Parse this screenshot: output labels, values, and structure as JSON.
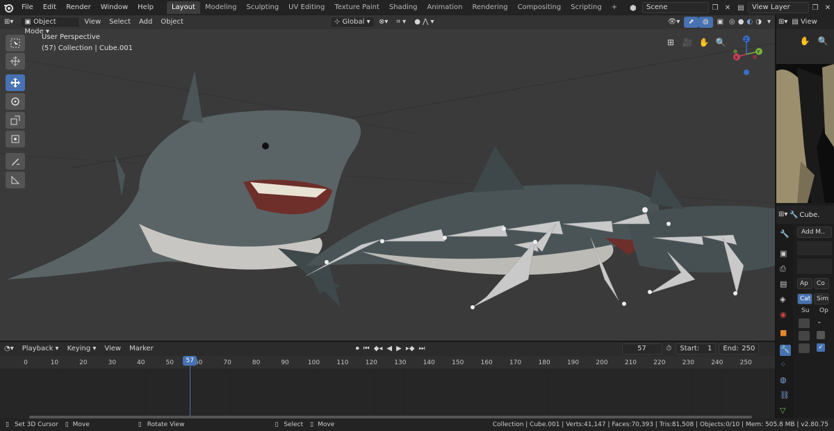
{
  "menu": [
    "File",
    "Edit",
    "Render",
    "Window",
    "Help"
  ],
  "workspaces": [
    "Layout",
    "Modeling",
    "Sculpting",
    "UV Editing",
    "Texture Paint",
    "Shading",
    "Animation",
    "Rendering",
    "Compositing",
    "Scripting"
  ],
  "active_workspace": "Layout",
  "add_tab": "+",
  "scene": "Scene",
  "view_layer": "View Layer",
  "viewport": {
    "mode": "Object Mode",
    "menus": [
      "View",
      "Select",
      "Add",
      "Object"
    ],
    "orientation": "Global",
    "info_line1": "User Perspective",
    "info_line2": "(57) Collection | Cube.001",
    "gizmo": {
      "z": "Z",
      "y": "Y",
      "x": "X"
    }
  },
  "image_editor": {
    "view_label": "View"
  },
  "properties": {
    "object_name": "Cube.",
    "add_modifier": "Add M..",
    "tab_ap": "Ap",
    "tab_co": "Co",
    "tab_cat": "Cat",
    "tab_sim": "Sim",
    "col_su": "Su",
    "col_op": "Op"
  },
  "timeline": {
    "menus": [
      "Playback",
      "Keying",
      "View",
      "Marker"
    ],
    "current_frame": "57",
    "start_label": "Start:",
    "start": "1",
    "end_label": "End:",
    "end": "250",
    "ticks": [
      0,
      10,
      20,
      30,
      40,
      50,
      60,
      70,
      80,
      90,
      100,
      110,
      120,
      130,
      140,
      150,
      160,
      170,
      180,
      190,
      200,
      210,
      220,
      230,
      240,
      250
    ],
    "playhead_frame": "57"
  },
  "status": {
    "left_click": "Set 3D Cursor",
    "mid_click": "Move",
    "right_click": "Rotate View",
    "select": "Select",
    "move": "Move",
    "info": "Collection | Cube.001 | Verts:41,147 | Faces:70,393 | Tris:81,508 | Objects:0/10 | Mem: 505.8 MB | v2.80.75"
  },
  "colors": {
    "accent": "#4772b3",
    "viewport_bg": "#3a3a3a",
    "header_bg": "#232323"
  }
}
